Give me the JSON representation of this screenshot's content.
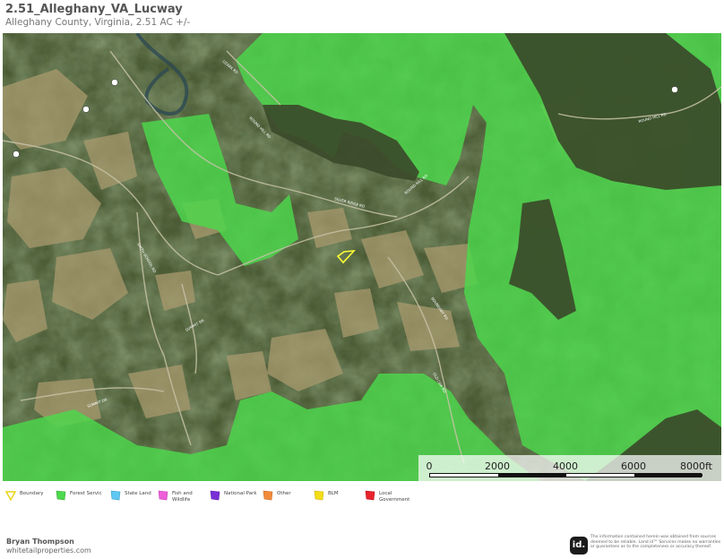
{
  "header": {
    "title": "2.51_Alleghany_VA_Lucway",
    "subtitle": "Alleghany County, Virginia, 2.51 AC +/-"
  },
  "map": {
    "base_layer": "satellite-imagery",
    "forest_service_color": "#4cd94c",
    "boundary_color": "#ffff33",
    "road_labels": [
      "OZARK RD",
      "ROUND HILL RD",
      "SILVER RIDGE RD",
      "ROUND HILL RD",
      "SUMMIT DR",
      "SMITH SCHOOL RD",
      "SUMMIT DR",
      "BOUNDARY RD",
      "OLD OAK RD",
      "ROUND HILL RD"
    ]
  },
  "scalebar": {
    "labels": [
      "0",
      "2000",
      "4000",
      "6000",
      "8000ft"
    ]
  },
  "legend": {
    "items": [
      {
        "label": "Boundary",
        "color": "#e6d619",
        "icon": "boundary-outline-icon"
      },
      {
        "label": "Forest Servic",
        "color": "#4cd94c",
        "icon": "forest-service-icon"
      },
      {
        "label": "State Land",
        "color": "#5ec8f2",
        "icon": "state-land-icon"
      },
      {
        "label": "Fish and Wildlife",
        "color": "#ee5ed8",
        "icon": "fish-wildlife-icon"
      },
      {
        "label": "National Park",
        "color": "#7a2ed6",
        "icon": "national-park-icon"
      },
      {
        "label": "Other",
        "color": "#f28a3a",
        "icon": "other-land-icon"
      },
      {
        "label": "BLM",
        "color": "#f4dd1a",
        "icon": "blm-icon"
      },
      {
        "label": "Local Government",
        "color": "#e8232d",
        "icon": "local-government-icon"
      }
    ]
  },
  "footer": {
    "author": "Bryan Thompson",
    "website": "whitetailproperties.com",
    "logo_text": "id.",
    "disclaimer": "The information contained herein was obtained from sources deemed to be reliable. Land id™ Services makes no warranties or guarantees as to the completeness or accuracy thereof."
  }
}
